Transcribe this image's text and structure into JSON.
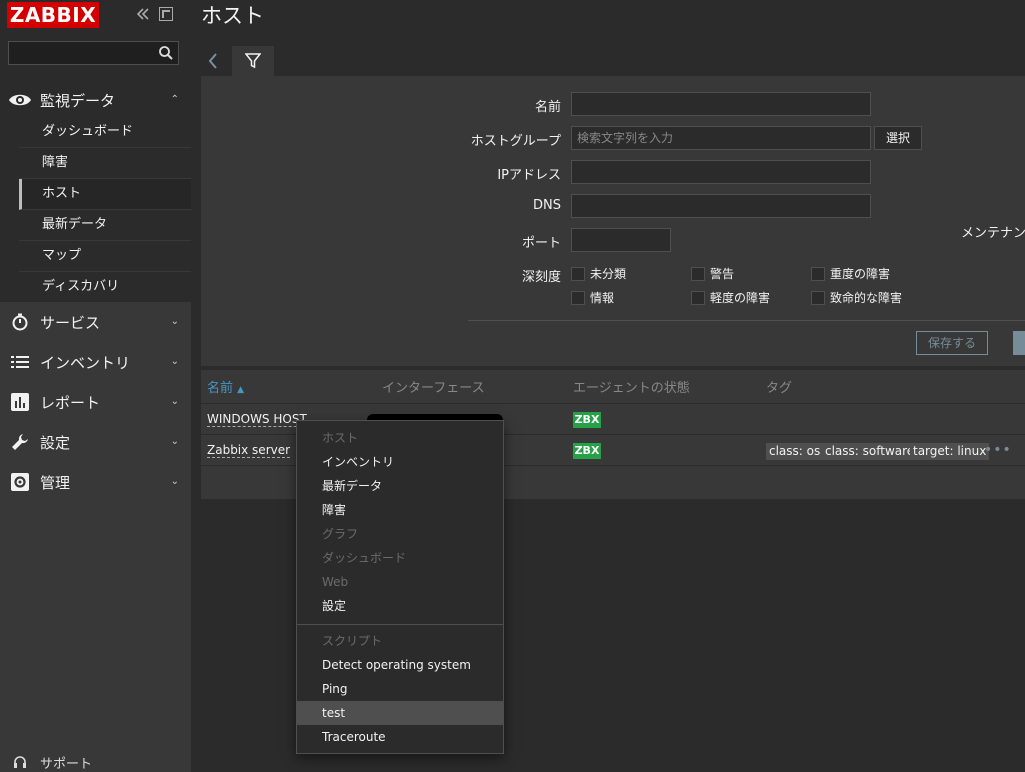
{
  "app": {
    "logo": "ZABBIX",
    "page_title": "ホスト"
  },
  "sidebar": {
    "open_section": {
      "label": "監視データ",
      "icon": "eye-icon"
    },
    "sub_items": [
      {
        "label": "ダッシュボード"
      },
      {
        "label": "障害"
      },
      {
        "label": "ホスト"
      },
      {
        "label": "最新データ"
      },
      {
        "label": "マップ"
      },
      {
        "label": "ディスカバリ"
      }
    ],
    "sections": [
      {
        "label": "サービス",
        "icon": "stopwatch-icon"
      },
      {
        "label": "インベントリ",
        "icon": "list-icon"
      },
      {
        "label": "レポート",
        "icon": "bar-chart-icon"
      },
      {
        "label": "設定",
        "icon": "wrench-icon"
      },
      {
        "label": "管理",
        "icon": "gear-icon"
      }
    ],
    "footer": {
      "label": "サポート",
      "icon": "headset-icon"
    }
  },
  "filter": {
    "name_label": "名前",
    "hostgroup_label": "ホストグループ",
    "hostgroup_placeholder": "検索文字列を入力",
    "select_button": "選択",
    "ip_label": "IPアドレス",
    "dns_label": "DNS",
    "port_label": "ポート",
    "severity_label": "深刻度",
    "maintenance_label": "メンテナンス",
    "severities": [
      "未分類",
      "警告",
      "重度の障害",
      "情報",
      "軽度の障害",
      "致命的な障害"
    ],
    "save_button": "保存する"
  },
  "table": {
    "headers": {
      "name": "名前",
      "interface": "インターフェース",
      "agent": "エージェントの状態",
      "tags": "タグ"
    },
    "rows": [
      {
        "name": "WINDOWS HOST",
        "agent": "ZBX",
        "tags": []
      },
      {
        "name": "Zabbix server",
        "agent": "ZBX",
        "tags": [
          "class: os",
          "class: software",
          "target: linux"
        ]
      }
    ]
  },
  "context_menu": {
    "items": [
      {
        "label": "ホスト",
        "state": "header"
      },
      {
        "label": "インベントリ",
        "state": "enabled"
      },
      {
        "label": "最新データ",
        "state": "enabled"
      },
      {
        "label": "障害",
        "state": "enabled"
      },
      {
        "label": "グラフ",
        "state": "disabled"
      },
      {
        "label": "ダッシュボード",
        "state": "disabled"
      },
      {
        "label": "Web",
        "state": "disabled"
      },
      {
        "label": "設定",
        "state": "enabled"
      }
    ],
    "scripts_header": "スクリプト",
    "scripts": [
      {
        "label": "Detect operating system"
      },
      {
        "label": "Ping"
      },
      {
        "label": "test"
      },
      {
        "label": "Traceroute"
      }
    ]
  },
  "colors": {
    "brand": "#d40000",
    "sort_link": "#4796c4",
    "agent_ok": "#26a148"
  }
}
